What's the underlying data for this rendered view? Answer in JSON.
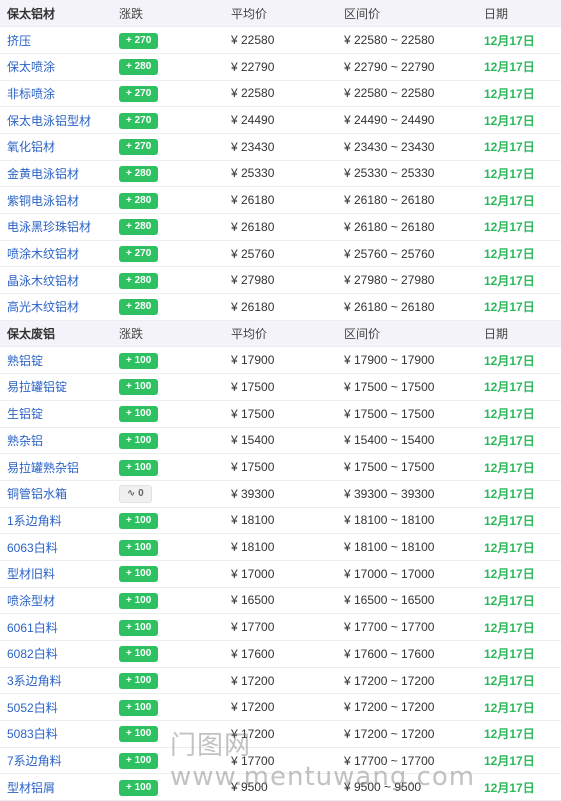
{
  "section1": {
    "header": [
      "保太铝材",
      "涨跌",
      "平均价",
      "区间价",
      "日期"
    ],
    "rows": [
      {
        "name": "挤压",
        "change": "+ 270",
        "avg": "¥ 22580",
        "range": "¥ 22580 ~ 22580",
        "date": "12月17日"
      },
      {
        "name": "保太喷涂",
        "change": "+ 280",
        "avg": "¥ 22790",
        "range": "¥ 22790 ~ 22790",
        "date": "12月17日"
      },
      {
        "name": "非标喷涂",
        "change": "+ 270",
        "avg": "¥ 22580",
        "range": "¥ 22580 ~ 22580",
        "date": "12月17日"
      },
      {
        "name": "保太电泳铝型材",
        "change": "+ 270",
        "avg": "¥ 24490",
        "range": "¥ 24490 ~ 24490",
        "date": "12月17日"
      },
      {
        "name": "氧化铝材",
        "change": "+ 270",
        "avg": "¥ 23430",
        "range": "¥ 23430 ~ 23430",
        "date": "12月17日"
      },
      {
        "name": "金黄电泳铝材",
        "change": "+ 280",
        "avg": "¥ 25330",
        "range": "¥ 25330 ~ 25330",
        "date": "12月17日"
      },
      {
        "name": "紫铜电泳铝材",
        "change": "+ 280",
        "avg": "¥ 26180",
        "range": "¥ 26180 ~ 26180",
        "date": "12月17日"
      },
      {
        "name": "电泳黑珍珠铝材",
        "change": "+ 280",
        "avg": "¥ 26180",
        "range": "¥ 26180 ~ 26180",
        "date": "12月17日"
      },
      {
        "name": "喷涂木纹铝材",
        "change": "+ 270",
        "avg": "¥ 25760",
        "range": "¥ 25760 ~ 25760",
        "date": "12月17日"
      },
      {
        "name": "晶泳木纹铝材",
        "change": "+ 280",
        "avg": "¥ 27980",
        "range": "¥ 27980 ~ 27980",
        "date": "12月17日"
      },
      {
        "name": "高光木纹铝材",
        "change": "+ 280",
        "avg": "¥ 26180",
        "range": "¥ 26180 ~ 26180",
        "date": "12月17日"
      }
    ]
  },
  "section2": {
    "header": [
      "保太废铝",
      "涨跌",
      "平均价",
      "区间价",
      "日期"
    ],
    "rows": [
      {
        "name": "熟铝锭",
        "change": "+ 100",
        "avg": "¥ 17900",
        "range": "¥ 17900 ~ 17900",
        "date": "12月17日"
      },
      {
        "name": "易拉罐铝锭",
        "change": "+ 100",
        "avg": "¥ 17500",
        "range": "¥ 17500 ~ 17500",
        "date": "12月17日"
      },
      {
        "name": "生铝锭",
        "change": "+ 100",
        "avg": "¥ 17500",
        "range": "¥ 17500 ~ 17500",
        "date": "12月17日"
      },
      {
        "name": "熟杂铝",
        "change": "+ 100",
        "avg": "¥ 15400",
        "range": "¥ 15400 ~ 15400",
        "date": "12月17日"
      },
      {
        "name": "易拉罐熟杂铝",
        "change": "+ 100",
        "avg": "¥ 17500",
        "range": "¥ 17500 ~ 17500",
        "date": "12月17日"
      },
      {
        "name": "铜管铝水箱",
        "change": "∿ 0",
        "avg": "¥ 39300",
        "range": "¥ 39300 ~ 39300",
        "date": "12月17日",
        "flat": true
      },
      {
        "name": "1系边角料",
        "change": "+ 100",
        "avg": "¥ 18100",
        "range": "¥ 18100 ~ 18100",
        "date": "12月17日"
      },
      {
        "name": "6063白料",
        "change": "+ 100",
        "avg": "¥ 18100",
        "range": "¥ 18100 ~ 18100",
        "date": "12月17日"
      },
      {
        "name": "型材旧料",
        "change": "+ 100",
        "avg": "¥ 17000",
        "range": "¥ 17000 ~ 17000",
        "date": "12月17日"
      },
      {
        "name": "喷涂型材",
        "change": "+ 100",
        "avg": "¥ 16500",
        "range": "¥ 16500 ~ 16500",
        "date": "12月17日"
      },
      {
        "name": "6061白料",
        "change": "+ 100",
        "avg": "¥ 17700",
        "range": "¥ 17700 ~ 17700",
        "date": "12月17日"
      },
      {
        "name": "6082白料",
        "change": "+ 100",
        "avg": "¥ 17600",
        "range": "¥ 17600 ~ 17600",
        "date": "12月17日"
      },
      {
        "name": "3系边角料",
        "change": "+ 100",
        "avg": "¥ 17200",
        "range": "¥ 17200 ~ 17200",
        "date": "12月17日"
      },
      {
        "name": "5052白料",
        "change": "+ 100",
        "avg": "¥ 17200",
        "range": "¥ 17200 ~ 17200",
        "date": "12月17日"
      },
      {
        "name": "5083白料",
        "change": "+ 100",
        "avg": "¥ 17200",
        "range": "¥ 17200 ~ 17200",
        "date": "12月17日"
      },
      {
        "name": "7系边角料",
        "change": "+ 100",
        "avg": "¥ 17700",
        "range": "¥ 17700 ~ 17700",
        "date": "12月17日"
      },
      {
        "name": "型材铝屑",
        "change": "+ 100",
        "avg": "¥ 9500",
        "range": "¥ 9500 ~ 9500",
        "date": "12月17日"
      }
    ]
  },
  "watermark": "门图网 www.mentuwang.com",
  "colors": {
    "up_badge": "#2ec061",
    "date": "#2eb85c",
    "link": "#2b63c6",
    "header_bg": "#f3f3f9"
  }
}
